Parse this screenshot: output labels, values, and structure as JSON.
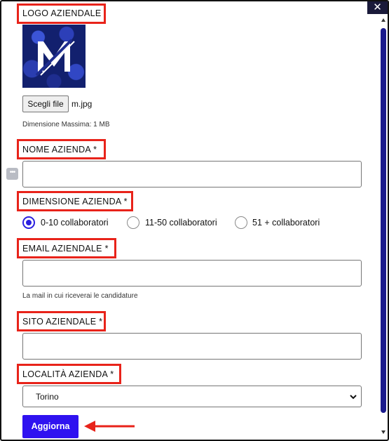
{
  "window": {
    "close_glyph": "✕"
  },
  "logo_section": {
    "label": "LOGO AZIENDALE",
    "image_icon": "company-logo-m",
    "choose_file_label": "Scegli file",
    "file_name": "m.jpg",
    "max_size_hint": "Dimensione Massima: 1 MB"
  },
  "company_name": {
    "label": "NOME AZIENDA *",
    "value": ""
  },
  "company_size": {
    "label": "DIMENSIONE AZIENDA *",
    "options": [
      {
        "label": "0-10 collaboratori",
        "checked": true
      },
      {
        "label": "11-50 collaboratori",
        "checked": false
      },
      {
        "label": "51 + collaboratori",
        "checked": false
      }
    ]
  },
  "company_email": {
    "label": "EMAIL AZIENDALE *",
    "value": "",
    "hint": "La mail in cui riceverai le candidature"
  },
  "company_site": {
    "label": "SITO AZIENDALE *",
    "value": ""
  },
  "company_location": {
    "label": "LOCALITÀ AZIENDA *",
    "selected": "Torino"
  },
  "submit": {
    "label": "Aggiorna"
  },
  "colors": {
    "highlight": "#e8231a",
    "accent": "#2f12f0",
    "radio": "#2a1fe0"
  }
}
